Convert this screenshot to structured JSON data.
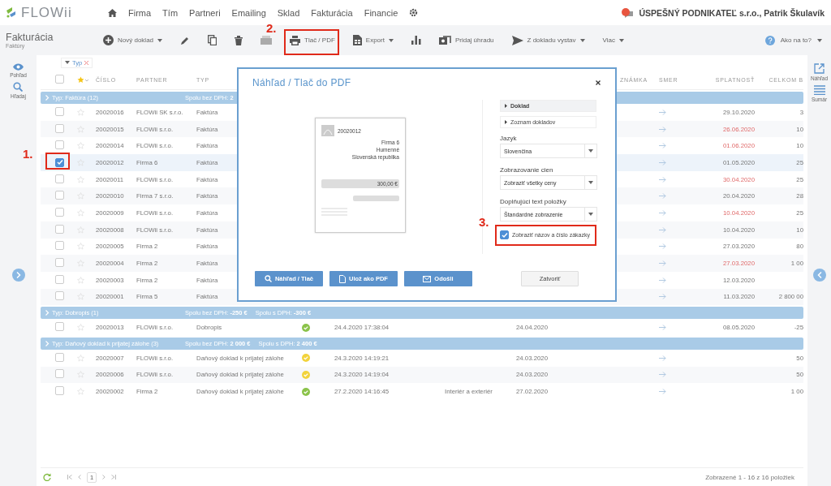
{
  "nav": {
    "logo": "FLOWii",
    "items": [
      "Firma",
      "Tím",
      "Partneri",
      "Emailing",
      "Sklad",
      "Fakturácia",
      "Financie"
    ],
    "account": "ÚSPEŠNÝ PODNIKATEĽ s.r.o., Patrik Škulavík"
  },
  "page": {
    "title": "Fakturácia",
    "subtitle": "Faktúry"
  },
  "toolbar": [
    {
      "kind": "add",
      "label": "Nový doklad",
      "menu": true
    },
    {
      "kind": "edit"
    },
    {
      "kind": "copy"
    },
    {
      "kind": "delete"
    },
    {
      "kind": "archive"
    },
    {
      "kind": "print",
      "label": "Tlač / PDF",
      "callout": "2."
    },
    {
      "kind": "export",
      "label": "Export",
      "menu": true
    },
    {
      "kind": "chart"
    },
    {
      "kind": "payment",
      "label": "Pridaj úhradu"
    },
    {
      "kind": "send",
      "label": "Z dokladu vystav",
      "menu": true
    },
    {
      "kind": "more",
      "label": "Viac",
      "menu": true
    }
  ],
  "help": {
    "label": "Ako na to?",
    "menu": true
  },
  "left_sidebar": [
    {
      "kind": "view",
      "label": "Pohľad"
    },
    {
      "kind": "search",
      "label": "Hľadaj"
    }
  ],
  "right_sidebar": [
    {
      "kind": "preview",
      "label": "Náhľad"
    },
    {
      "kind": "summary",
      "label": "Sumár"
    }
  ],
  "filter": {
    "chip": "Typ"
  },
  "table": {
    "columns": {
      "number": "ČÍSLO",
      "partner": "PARTNER",
      "type": "TYP",
      "note": "ZNÁMKA",
      "direction": "SMER",
      "due": "SPLATNOSŤ",
      "total": "CELKOM B"
    },
    "select_all": false,
    "groups": [
      {
        "title": "Typ: Faktúra (12)",
        "summary": [
          "Spolu bez DPH: **2**"
        ],
        "rows": [
          {
            "checked": false,
            "number": "20020016",
            "partner": "FLOWii SK s.r.o.",
            "type": "Faktúra",
            "due": "29.10.2020",
            "overdue": false,
            "total": "3"
          },
          {
            "checked": false,
            "number": "20020015",
            "partner": "FLOWii s.r.o.",
            "type": "Faktúra",
            "due": "26.06.2020",
            "overdue": true,
            "total": "10"
          },
          {
            "checked": false,
            "number": "20020014",
            "partner": "FLOWii s.r.o.",
            "type": "Faktúra",
            "due": "01.06.2020",
            "overdue": true,
            "total": "10"
          },
          {
            "checked": true,
            "callout": "1.",
            "number": "20020012",
            "partner": "Firma 6",
            "type": "Faktúra",
            "due": "01.05.2020",
            "overdue": false,
            "total": "25"
          },
          {
            "checked": false,
            "number": "20020011",
            "partner": "FLOWii s.r.o.",
            "type": "Faktúra",
            "due": "30.04.2020",
            "overdue": true,
            "total": "25"
          },
          {
            "checked": false,
            "number": "20020010",
            "partner": "Firma 7 s.r.o.",
            "type": "Faktúra",
            "due": "20.04.2020",
            "overdue": false,
            "total": "28"
          },
          {
            "checked": false,
            "number": "20020009",
            "partner": "FLOWii s.r.o.",
            "type": "Faktúra",
            "due": "10.04.2020",
            "overdue": true,
            "total": "25"
          },
          {
            "checked": false,
            "number": "20020008",
            "partner": "FLOWii s.r.o.",
            "type": "Faktúra",
            "due": "10.04.2020",
            "overdue": false,
            "total": "10"
          },
          {
            "checked": false,
            "number": "20020005",
            "partner": "Firma 2",
            "type": "Faktúra",
            "due": "27.03.2020",
            "overdue": false,
            "total": "80"
          },
          {
            "checked": false,
            "number": "20020004",
            "partner": "Firma 2",
            "type": "Faktúra",
            "due": "27.03.2020",
            "overdue": true,
            "total": "1 00"
          },
          {
            "checked": false,
            "number": "20020003",
            "partner": "Firma 2",
            "type": "Faktúra",
            "due": "12.03.2020",
            "overdue": false
          },
          {
            "checked": false,
            "number": "20020001",
            "partner": "Firma 5",
            "type": "Faktúra",
            "due": "11.03.2020",
            "overdue": false,
            "total": "2 800 00"
          }
        ]
      },
      {
        "title": "Typ: Dobropis (1)",
        "summary": [
          "Spolu bez DPH: **-250 €**",
          "Spolu s DPH: **-300 €**"
        ],
        "rows": [
          {
            "checked": false,
            "number": "20020013",
            "partner": "FLOWii s.r.o.",
            "type": "Dobropis",
            "color": "#8bc34a",
            "created": "24.4.2020 17:38:04",
            "date": "24.04.2020",
            "due": "08.05.2020",
            "overdue": false,
            "total": "-25"
          }
        ]
      },
      {
        "title": "Typ: Daňový doklad k prijatej zálohe (3)",
        "summary": [
          "Spolu bez DPH: **2 000 €**",
          "Spolu s DPH: **2 400 €**"
        ],
        "rows": [
          {
            "checked": false,
            "number": "20020007",
            "partner": "FLOWii s.r.o.",
            "type": "Daňový doklad k prijatej zálohe",
            "color": "#f2d33c",
            "created": "24.3.2020 14:19:21",
            "date": "24.03.2020",
            "total": "50"
          },
          {
            "checked": false,
            "number": "20020006",
            "partner": "FLOWii s.r.o.",
            "type": "Daňový doklad k prijatej zálohe",
            "color": "#f2d33c",
            "created": "24.3.2020 14:19:04",
            "date": "24.03.2020",
            "total": "50"
          },
          {
            "checked": false,
            "number": "20020002",
            "partner": "Firma 2",
            "type": "Daňový doklad k prijatej zálohe",
            "color": "#8bc34a",
            "created": "27.2.2020 14:16:45",
            "order": "Interiér a exteriér",
            "date": "27.02.2020",
            "total": "1 00"
          }
        ]
      }
    ]
  },
  "pager": {
    "page": "1",
    "info": "Zobrazené 1 - 16 z 16 položiek"
  },
  "dialog": {
    "title": "Náhľad / Tlač do PDF",
    "preview": {
      "number": "20020012",
      "address": [
        "Firma 6",
        "Humenné",
        "Slovenská republika"
      ],
      "amount": "300,00 €"
    },
    "sections": [
      {
        "label": "Doklad",
        "selected": true
      },
      {
        "label": "Zoznam dokladov",
        "selected": false
      }
    ],
    "fields": [
      {
        "label": "Jazyk",
        "value": "Slovenčina"
      },
      {
        "label": "Zobrazovanie cien",
        "value": "Zobraziť všetky ceny"
      },
      {
        "label": "Doplňujúci text položky",
        "value": "Štandardné zobrazenie"
      }
    ],
    "option": {
      "label": "Zobraziť názov a číslo zákazky",
      "checked": true,
      "callout": "3."
    },
    "buttons": [
      {
        "kind": "preview",
        "label": "Náhľad / Tlač"
      },
      {
        "kind": "pdf",
        "label": "Ulož ako PDF"
      },
      {
        "kind": "send",
        "label": "Odošli"
      },
      {
        "kind": "close",
        "label": "Zatvoriť"
      }
    ]
  }
}
